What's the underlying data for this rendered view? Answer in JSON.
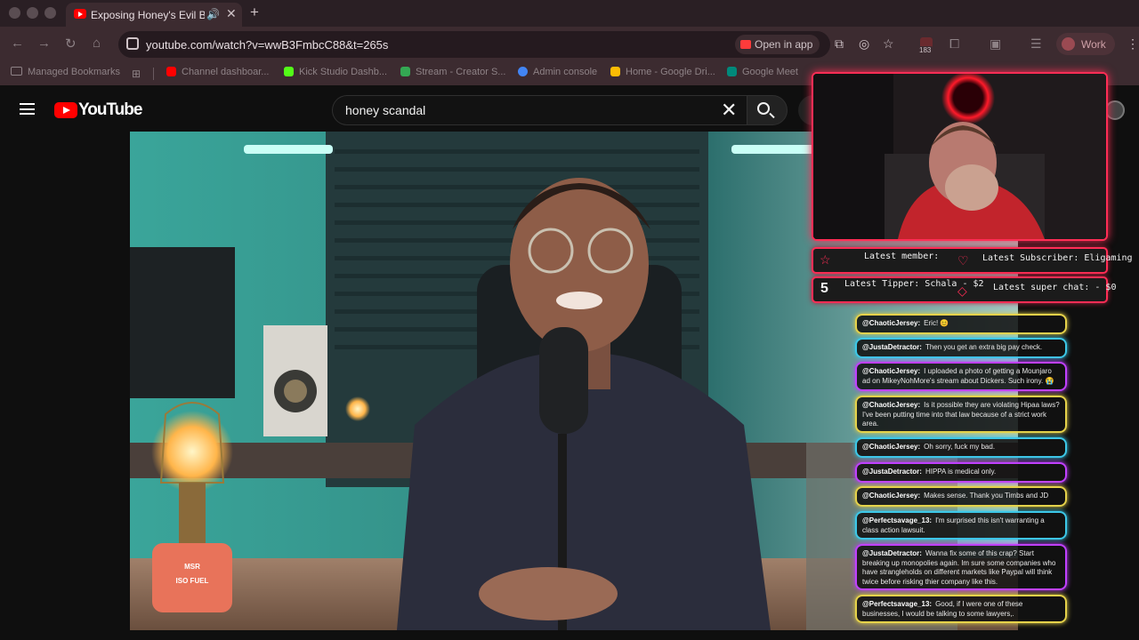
{
  "browser": {
    "tab_title": "Exposing Honey's Evil Bu",
    "url": "youtube.com/watch?v=wwB3FmbcC88&t=265s",
    "open_in_app": "Open in app",
    "extension_count": "183",
    "profile_label": "Work",
    "bookmarks": [
      {
        "label": "Managed Bookmarks",
        "color": "#8e8286"
      },
      {
        "label": "Channel dashboar...",
        "color": "#ff0000"
      },
      {
        "label": "Kick Studio Dashb...",
        "color": "#53fc18"
      },
      {
        "label": "Stream - Creator S...",
        "color": "#34a853"
      },
      {
        "label": "Admin console",
        "color": "#4285f4"
      },
      {
        "label": "Home - Google Dri...",
        "color": "#fbbc04"
      },
      {
        "label": "Google Meet",
        "color": "#00897b"
      }
    ]
  },
  "youtube": {
    "logo_text": "YouTube",
    "search_value": "honey scandal"
  },
  "overlay": {
    "latest_member": "Latest member:",
    "latest_subscriber": "Latest Subscriber: Eligaming",
    "latest_tipper": "Latest Tipper: Schala - $2",
    "latest_superchat": "Latest super chat:  - $0",
    "tipper_badge": "5",
    "chat": [
      {
        "user": "@ChaoticJersey:",
        "text": "Eric! 😊",
        "color": "y"
      },
      {
        "user": "@JustaDetractor:",
        "text": "Then you get an extra big pay check.",
        "color": "c"
      },
      {
        "user": "@ChaoticJersey:",
        "text": "I uploaded a photo of getting a Mounjaro ad on MikeyNohMore's stream about Dickers. Such irony. 😭",
        "color": "p"
      },
      {
        "user": "@ChaoticJersey:",
        "text": "Is it possible they are violating Hipaa laws? I've been putting time into that law because of a strict work area.",
        "color": "y"
      },
      {
        "user": "@ChaoticJersey:",
        "text": "Oh sorry, fuck my bad.",
        "color": "c"
      },
      {
        "user": "@JustaDetractor:",
        "text": "HIPPA is medical only.",
        "color": "p"
      },
      {
        "user": "@ChaoticJersey:",
        "text": "Makes sense. Thank you Timbs and JD",
        "color": "y"
      },
      {
        "user": "@Perfectsavage_13:",
        "text": "I'm surprised this isn't warranting a class action lawsuit.",
        "color": "c"
      },
      {
        "user": "@JustaDetractor:",
        "text": "Wanna fix some of this crap? Start breaking up monopolies again. Im sure some companies who have strangleholds on different markets like Paypal will think twice before risking thier company like this.",
        "color": "p"
      },
      {
        "user": "@Perfectsavage_13:",
        "text": "Good, if I were one of these businesses, I would be talking to some lawyers,.",
        "color": "y"
      }
    ]
  },
  "video": {
    "mug_text_top": "MSR",
    "mug_text_bottom": "ISO FUEL"
  }
}
